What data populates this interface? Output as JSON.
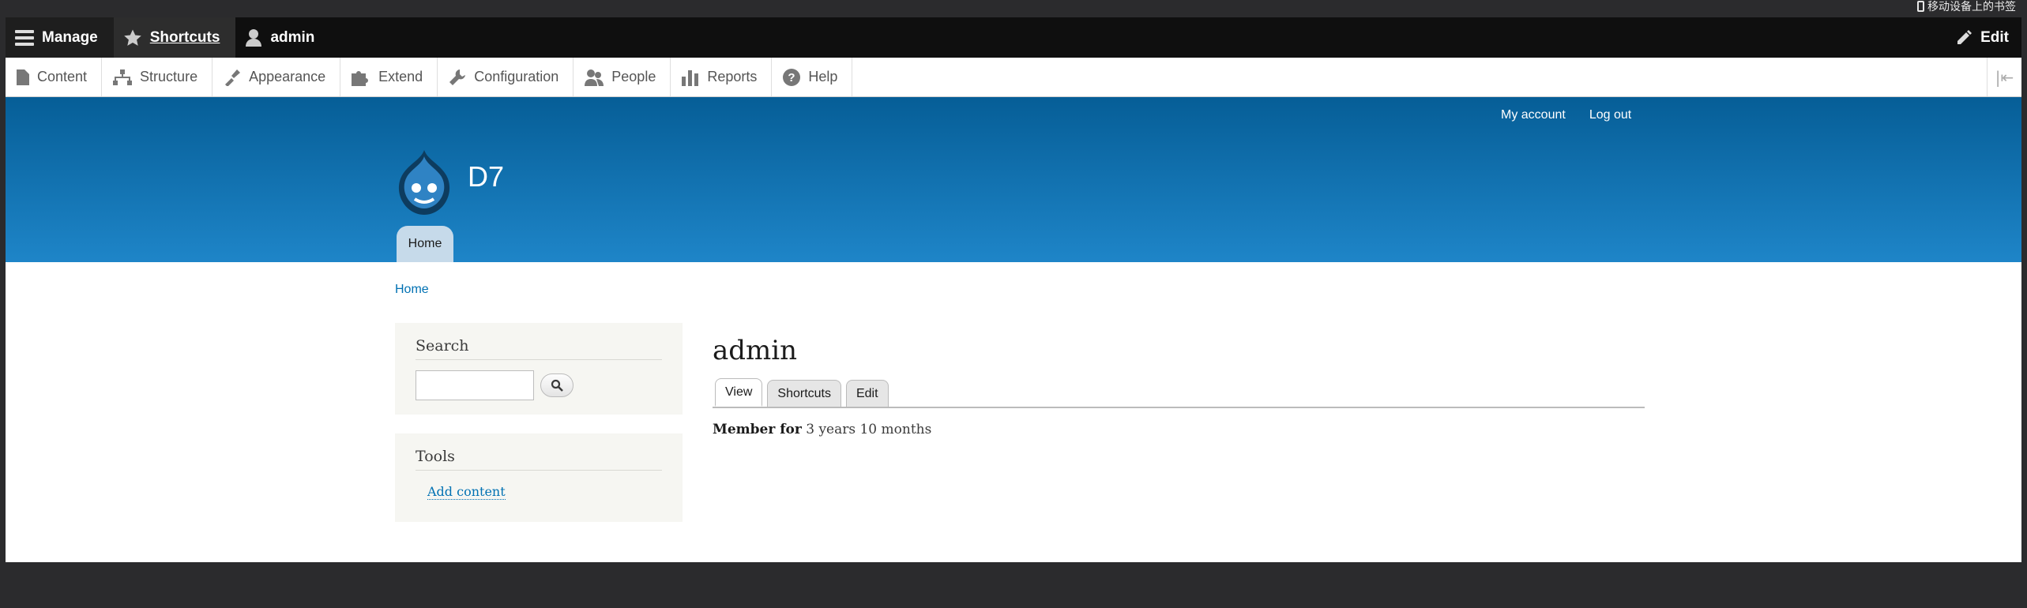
{
  "browser": {
    "mobile_bookmarks_label": "移动设备上的书签"
  },
  "toolbar": {
    "manage_label": "Manage",
    "shortcuts_label": "Shortcuts",
    "user_label": "admin",
    "edit_label": "Edit"
  },
  "tray": {
    "items": [
      {
        "label": "Content",
        "icon": "file-icon"
      },
      {
        "label": "Structure",
        "icon": "sitemap-icon"
      },
      {
        "label": "Appearance",
        "icon": "paintbrush-icon"
      },
      {
        "label": "Extend",
        "icon": "puzzle-icon"
      },
      {
        "label": "Configuration",
        "icon": "wrench-icon"
      },
      {
        "label": "People",
        "icon": "people-icon"
      },
      {
        "label": "Reports",
        "icon": "bar-chart-icon"
      },
      {
        "label": "Help",
        "icon": "help-icon"
      }
    ]
  },
  "header": {
    "secondary_menu": [
      "My account",
      "Log out"
    ],
    "site_name": "D7",
    "primary_tab": "Home"
  },
  "breadcrumb": "Home",
  "sidebar": {
    "search_title": "Search",
    "search_value": "",
    "tools_title": "Tools",
    "tools_link": "Add content"
  },
  "main": {
    "title": "admin",
    "tabs": [
      "View",
      "Shortcuts",
      "Edit"
    ],
    "active_tab": "View",
    "member_label": "Member for",
    "member_value": "3 years 10 months"
  },
  "colors": {
    "header_top": "#065e97",
    "header_bottom": "#1e85c8",
    "link": "#0071b3",
    "toolbar_bg": "#0f0f0f"
  }
}
